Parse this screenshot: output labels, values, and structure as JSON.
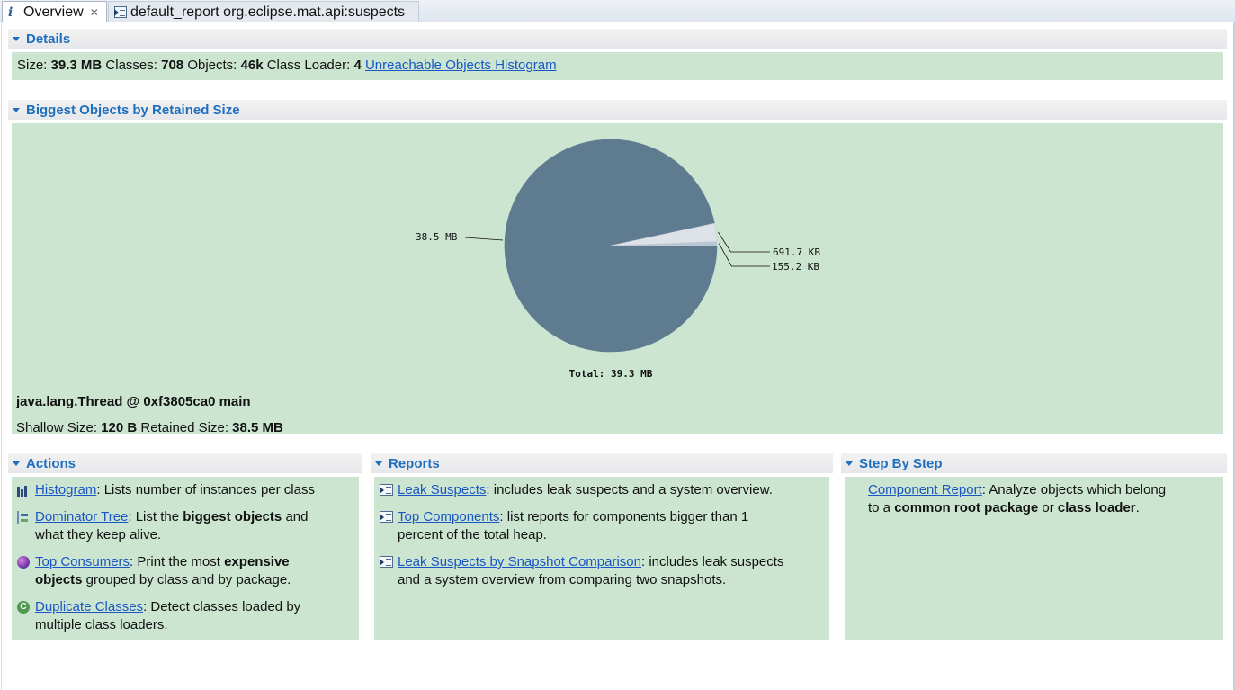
{
  "tabs": [
    {
      "label": "Overview",
      "active": true,
      "icon": "info-icon"
    },
    {
      "label": "default_report  org.eclipse.mat.api:suspects",
      "active": false,
      "icon": "report-icon"
    }
  ],
  "details": {
    "title": "Details",
    "size_label": "Size:",
    "size_value": "39.3 MB",
    "classes_label": "Classes:",
    "classes_value": "708",
    "objects_label": "Objects:",
    "objects_value": "46k",
    "classloader_label": "Class Loader:",
    "classloader_value": "4",
    "unreachable_link": "Unreachable Objects Histogram"
  },
  "biggest": {
    "title": "Biggest Objects by Retained Size",
    "selected_title": "java.lang.Thread @ 0xf3805ca0 main",
    "shallow_label": "Shallow Size:",
    "shallow_value": "120 B",
    "retained_label": "Retained Size:",
    "retained_value": "38.5 MB"
  },
  "chart_data": {
    "type": "pie",
    "total_label": "Total: 39.3 MB",
    "slices": [
      {
        "label": "38.5 MB",
        "value": 38.5,
        "unit": "MB",
        "color": "#5f7b90"
      },
      {
        "label": "691.7 KB",
        "value": 0.6755,
        "unit": "MB",
        "color": "#dde2e8"
      },
      {
        "label": "155.2 KB",
        "value": 0.1516,
        "unit": "MB",
        "color": "#b8c7d3"
      }
    ]
  },
  "actions": {
    "title": "Actions",
    "items": [
      {
        "icon": "histogram-icon",
        "link": "Histogram",
        "text_pre": ": Lists number of instances per class"
      },
      {
        "icon": "dominator-tree-icon",
        "link": "Dominator Tree",
        "text_pre": ": List the ",
        "bold": "biggest objects",
        "text_post": " and",
        "line2": "what they keep alive."
      },
      {
        "icon": "top-consumers-icon",
        "link": "Top Consumers",
        "text_pre": ": Print the most ",
        "bold": "expensive",
        "line2_bold": "objects",
        "line2": " grouped by class and by package."
      },
      {
        "icon": "duplicate-classes-icon",
        "link": "Duplicate Classes",
        "text_pre": ": Detect classes loaded by",
        "line2": "multiple class loaders."
      }
    ]
  },
  "reports": {
    "title": "Reports",
    "items": [
      {
        "icon": "report-icon",
        "link": "Leak Suspects",
        "text_pre": ": includes leak suspects and a system overview."
      },
      {
        "icon": "report-icon",
        "link": "Top Components",
        "text_pre": ": list reports for components bigger than 1",
        "line2": "percent of the total heap."
      },
      {
        "icon": "report-icon",
        "link": "Leak Suspects by Snapshot Comparison",
        "text_pre": ": includes leak suspects",
        "line2": "and a system overview from comparing two snapshots."
      }
    ]
  },
  "stepbystep": {
    "title": "Step By Step",
    "link": "Component Report",
    "text_pre": ": Analyze objects which belong",
    "line2_pre": "to a ",
    "bold1": "common root package",
    "mid": " or ",
    "bold2": "class loader",
    "end": "."
  }
}
